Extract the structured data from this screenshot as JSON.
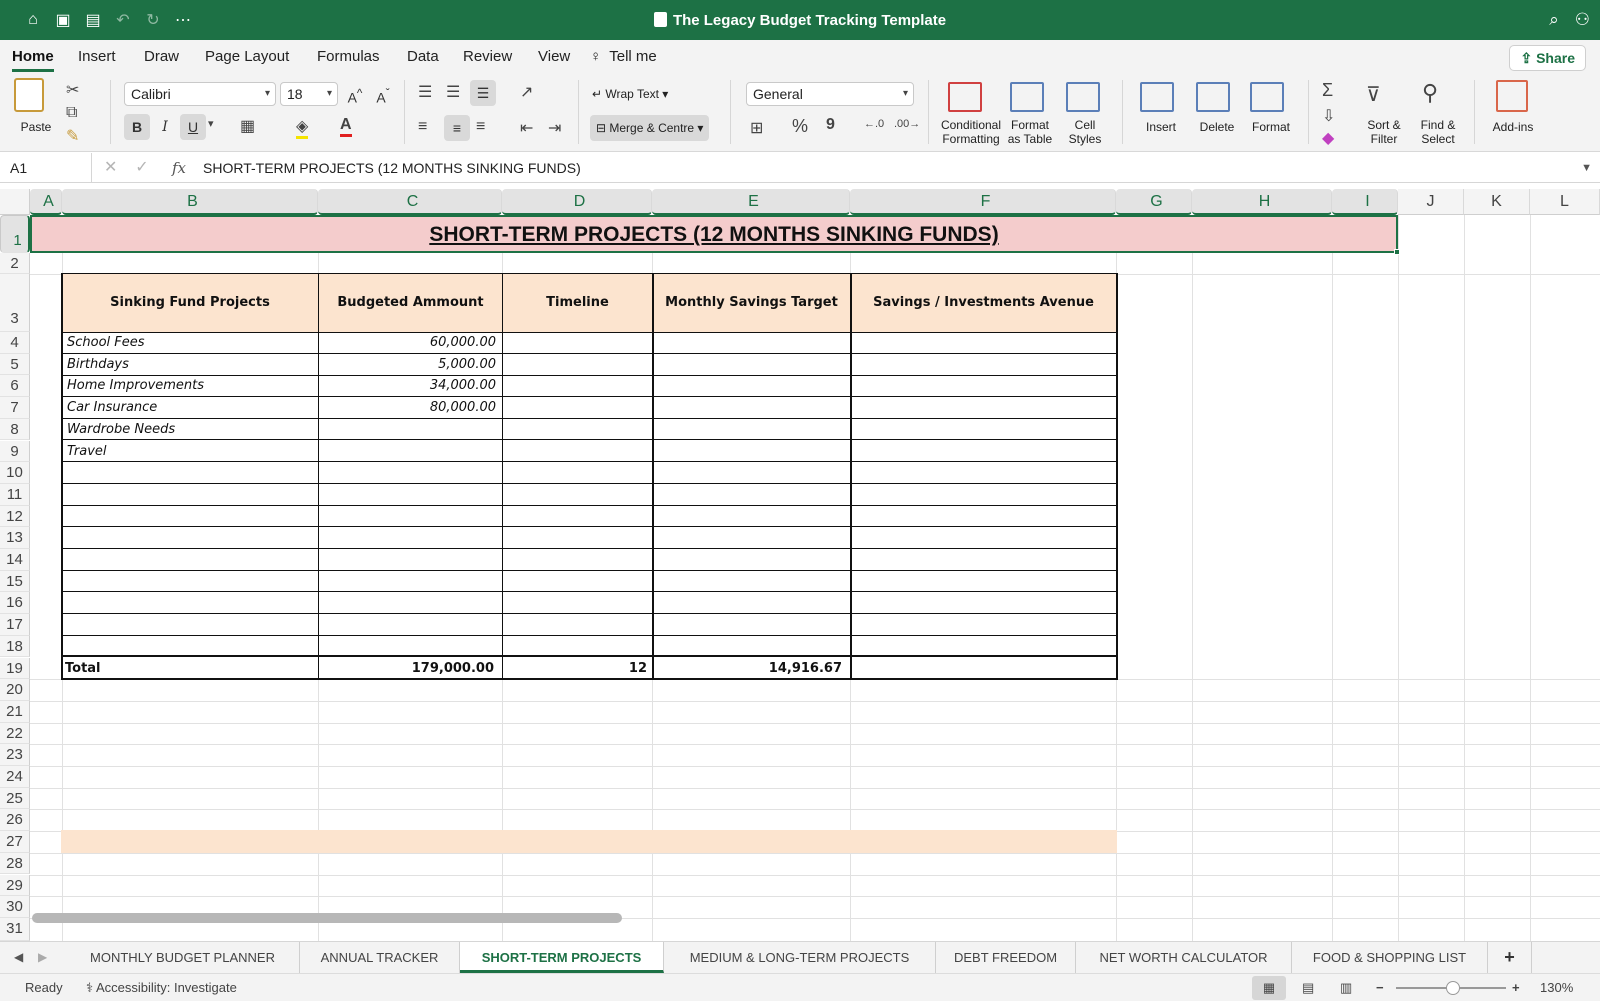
{
  "window": {
    "title": "The Legacy Budget Tracking Template",
    "quick_access": [
      "home-icon",
      "save-icon",
      "save-as-icon",
      "undo-icon",
      "redo-icon",
      "more-icon"
    ],
    "right_icons": [
      "search-icon",
      "account-icon"
    ]
  },
  "ribbon_tabs": [
    "Home",
    "Insert",
    "Draw",
    "Page Layout",
    "Formulas",
    "Data",
    "Review",
    "View"
  ],
  "tell_me": "Tell me",
  "share_label": "Share",
  "ribbon": {
    "paste_label": "Paste",
    "font_name": "Calibri",
    "font_size": "18",
    "bold": "B",
    "italic": "I",
    "underline": "U",
    "wrap_text": "Wrap Text",
    "merge_centre": "Merge & Centre",
    "number_format": "General",
    "percent": "%",
    "comma": "9",
    "conditional_formatting": [
      "Conditional",
      "Formatting"
    ],
    "format_as_table": [
      "Format",
      "as Table"
    ],
    "cell_styles": [
      "Cell",
      "Styles"
    ],
    "insert": "Insert",
    "delete": "Delete",
    "format": "Format",
    "sort_filter": [
      "Sort &",
      "Filter"
    ],
    "find_select": [
      "Find &",
      "Select"
    ],
    "add_ins": "Add-ins"
  },
  "formula_bar": {
    "name_box": "A1",
    "fx": "fx",
    "content": "SHORT-TERM PROJECTS (12 MONTHS SINKING FUNDS)"
  },
  "columns": [
    "A",
    "B",
    "C",
    "D",
    "E",
    "F",
    "G",
    "H",
    "I",
    "J",
    "K",
    "L"
  ],
  "rows": [
    "1",
    "2",
    "3",
    "4",
    "5",
    "6",
    "7",
    "8",
    "9",
    "10",
    "11",
    "12",
    "13",
    "14",
    "15",
    "16",
    "17",
    "18",
    "19",
    "20",
    "21",
    "22",
    "23",
    "24",
    "25",
    "26",
    "27",
    "28",
    "29",
    "30",
    "31"
  ],
  "sheet": {
    "title": "SHORT-TERM PROJECTS (12 MONTHS SINKING FUNDS)",
    "headers": [
      "Sinking Fund Projects",
      "Budgeted Ammount",
      "Timeline",
      "Monthly Savings Target",
      "Savings / Investments Avenue"
    ],
    "items": [
      {
        "name": "School Fees",
        "amount": "60,000.00"
      },
      {
        "name": "Birthdays",
        "amount": "5,000.00"
      },
      {
        "name": "Home Improvements",
        "amount": "34,000.00"
      },
      {
        "name": "Car Insurance",
        "amount": "80,000.00"
      },
      {
        "name": "Wardrobe Needs",
        "amount": ""
      },
      {
        "name": "Travel",
        "amount": ""
      }
    ],
    "total": {
      "label": "Total",
      "amount": "179,000.00",
      "timeline": "12",
      "monthly": "14,916.67"
    }
  },
  "sheet_tabs": [
    "MONTHLY BUDGET PLANNER",
    "ANNUAL TRACKER",
    "SHORT-TERM PROJECTS",
    "MEDIUM & LONG-TERM PROJECTS",
    "DEBT FREEDOM",
    "NET WORTH CALCULATOR",
    "FOOD & SHOPPING LIST"
  ],
  "active_sheet": "SHORT-TERM PROJECTS",
  "status": {
    "ready": "Ready",
    "accessibility": "Accessibility: Investigate",
    "zoom": "130%"
  },
  "colors": {
    "accent": "#1d7145",
    "title_fill": "#f4cccc",
    "header_fill": "#fce4cf"
  }
}
